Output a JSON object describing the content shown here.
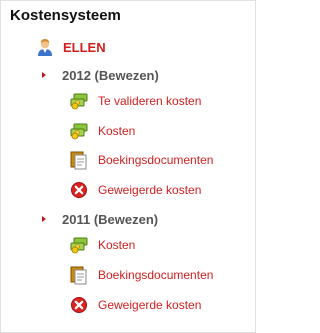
{
  "panel": {
    "title": "Kostensysteem"
  },
  "user": {
    "name": "ELLEN",
    "icon": "user-icon"
  },
  "years": [
    {
      "label": "2012 (Bewezen)",
      "items": [
        {
          "label": "Te valideren kosten",
          "icon": "money-icon"
        },
        {
          "label": "Kosten",
          "icon": "money-icon"
        },
        {
          "label": "Boekingsdocumenten",
          "icon": "documents-icon"
        },
        {
          "label": "Geweigerde kosten",
          "icon": "rejected-icon"
        }
      ]
    },
    {
      "label": "2011 (Bewezen)",
      "items": [
        {
          "label": "Kosten",
          "icon": "money-icon"
        },
        {
          "label": "Boekingsdocumenten",
          "icon": "documents-icon"
        },
        {
          "label": "Geweigerde kosten",
          "icon": "rejected-icon"
        }
      ]
    }
  ],
  "colors": {
    "link": "#d11f1f",
    "heading": "#111111",
    "year": "#555555",
    "reject_icon": "#dd2222",
    "money_icon": "#7ab317"
  }
}
